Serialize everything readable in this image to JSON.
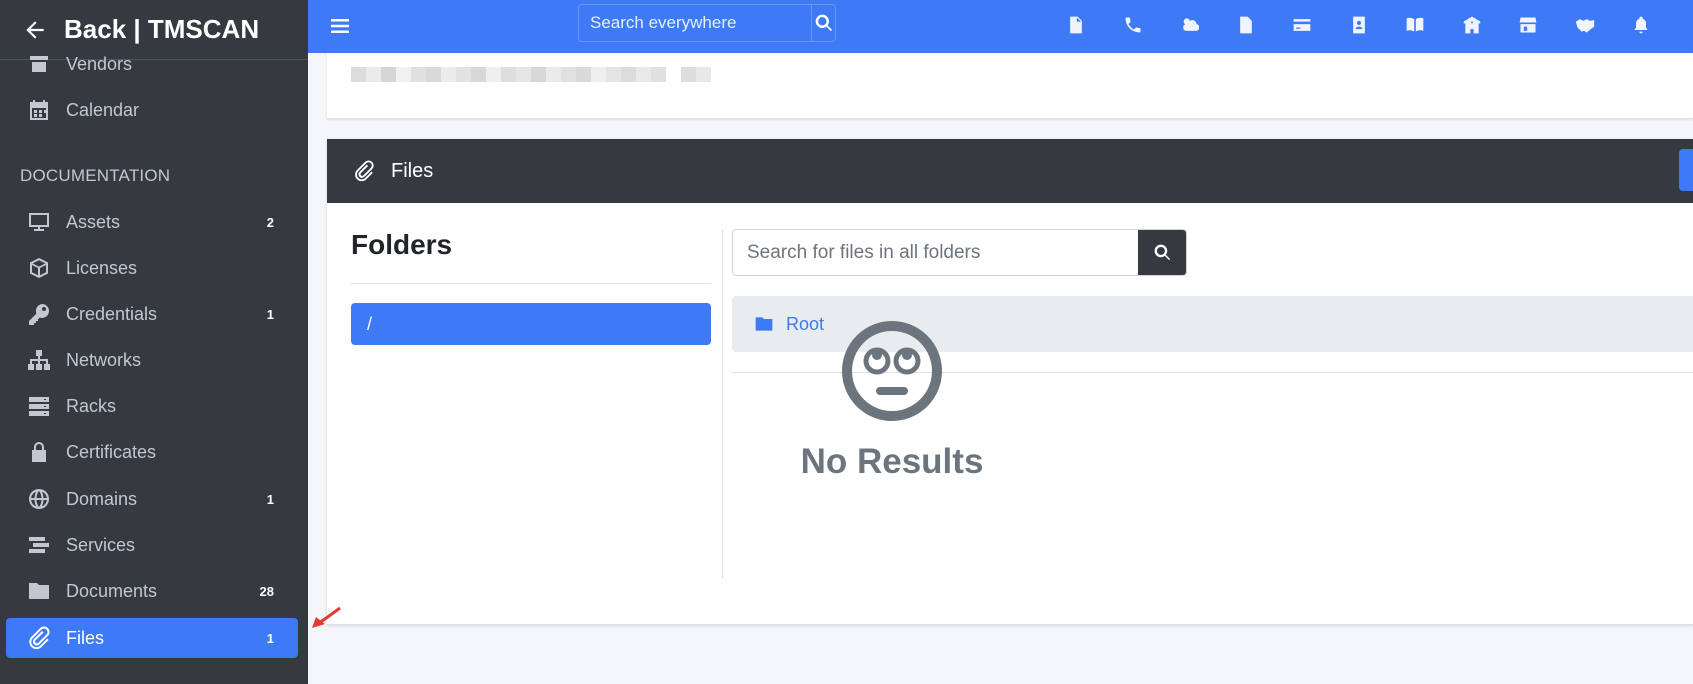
{
  "sidebar": {
    "brand_label": "Back | TMSCAN",
    "partial_item_label": "Vendors",
    "calendar_label": "Calendar",
    "section_header": "DOCUMENTATION",
    "items": [
      {
        "label": "Assets",
        "badge": "2",
        "icon": "desktop-icon"
      },
      {
        "label": "Licenses",
        "badge": "",
        "icon": "cube-icon"
      },
      {
        "label": "Credentials",
        "badge": "1",
        "icon": "key-icon"
      },
      {
        "label": "Networks",
        "badge": "",
        "icon": "network-icon"
      },
      {
        "label": "Racks",
        "badge": "",
        "icon": "server-icon"
      },
      {
        "label": "Certificates",
        "badge": "",
        "icon": "lock-icon"
      },
      {
        "label": "Domains",
        "badge": "1",
        "icon": "globe-icon"
      },
      {
        "label": "Services",
        "badge": "",
        "icon": "stream-icon"
      },
      {
        "label": "Documents",
        "badge": "28",
        "icon": "folder-icon"
      },
      {
        "label": "Files",
        "badge": "1",
        "icon": "paperclip-icon",
        "active": true
      }
    ]
  },
  "topbar": {
    "search_placeholder": "Search everywhere",
    "icons": [
      "file-icon",
      "phone-icon",
      "cloud-sun-icon",
      "document-icon",
      "credit-card-icon",
      "contact-icon",
      "book-icon",
      "building-icon",
      "store-icon",
      "handshake-icon",
      "bell-icon"
    ]
  },
  "files_card": {
    "header_title": "Files",
    "folders_title": "Folders",
    "root_folder_label": "/",
    "search_placeholder": "Search for files in all folders",
    "breadcrumb_label": "Root",
    "empty_text": "No Results"
  },
  "colors": {
    "accent": "#3e7af5",
    "sidebar_bg": "#343a40",
    "content_bg": "#f4f6f9"
  }
}
